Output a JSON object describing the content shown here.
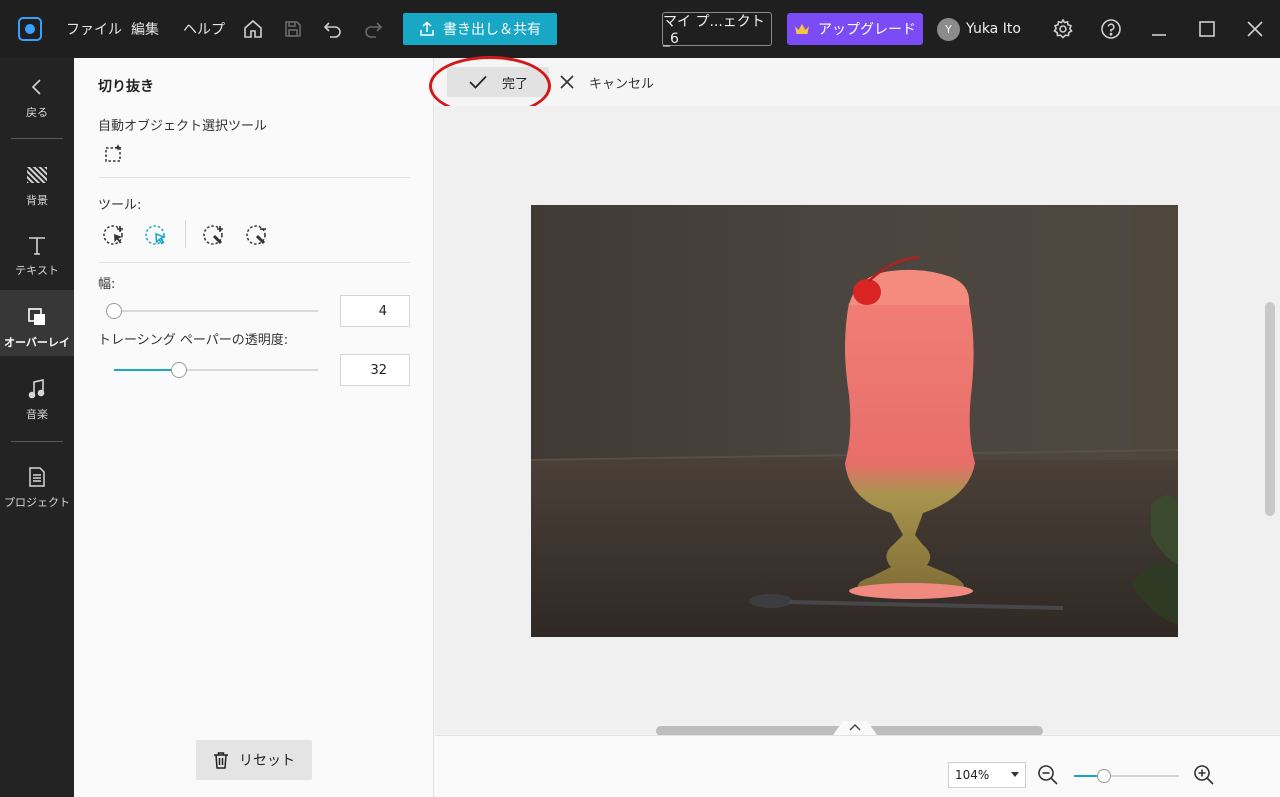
{
  "titlebar": {
    "menus": [
      "ファイル",
      "編集",
      "ヘルプ"
    ],
    "export_label": "書き出し＆共有",
    "project_name": "マイ プ...ェクト_6",
    "upgrade_label": "アップグレード",
    "avatar_initial": "Y",
    "user_name": "Yuka Ito"
  },
  "leftnav": {
    "back_label": "戻る",
    "items": [
      "背景",
      "テキスト",
      "オーバーレイ",
      "音楽",
      "プロジェクト"
    ],
    "active_index": 2
  },
  "panel": {
    "title": "切り抜き",
    "auto_select_label": "自動オブジェクト選択ツール",
    "tools_label": "ツール:",
    "width_label": "幅:",
    "width_value": "4",
    "width_fraction": 0.0,
    "opacity_label": "トレーシング ペーパーの透明度:",
    "opacity_value": "32",
    "opacity_fraction": 0.32,
    "reset_label": "リセット"
  },
  "actionbar": {
    "done_label": "完了",
    "cancel_label": "キャンセル"
  },
  "bottombar": {
    "zoom_value": "104%",
    "zoom_fraction": 0.29
  },
  "colors": {
    "accent": "#19a7c6",
    "upgrade": "#7b4cf5",
    "highlight": "#d01a1a"
  }
}
